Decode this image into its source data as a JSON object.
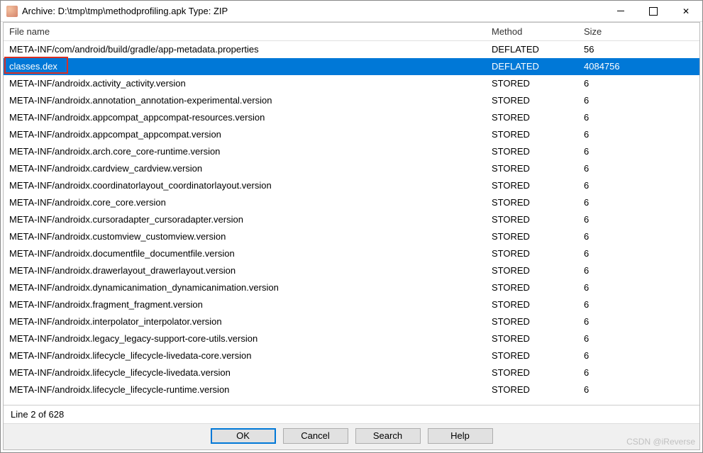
{
  "window": {
    "title": "Archive: D:\\tmp\\tmp\\methodprofiling.apk Type: ZIP"
  },
  "columns": {
    "name": "File name",
    "method": "Method",
    "size": "Size"
  },
  "rows": [
    {
      "name": "META-INF/com/android/build/gradle/app-metadata.properties",
      "method": "DEFLATED",
      "size": "56",
      "selected": false
    },
    {
      "name": "classes.dex",
      "method": "DEFLATED",
      "size": "4084756",
      "selected": true,
      "highlighted": true
    },
    {
      "name": "META-INF/androidx.activity_activity.version",
      "method": "STORED",
      "size": "6",
      "selected": false
    },
    {
      "name": "META-INF/androidx.annotation_annotation-experimental.version",
      "method": "STORED",
      "size": "6",
      "selected": false
    },
    {
      "name": "META-INF/androidx.appcompat_appcompat-resources.version",
      "method": "STORED",
      "size": "6",
      "selected": false
    },
    {
      "name": "META-INF/androidx.appcompat_appcompat.version",
      "method": "STORED",
      "size": "6",
      "selected": false
    },
    {
      "name": "META-INF/androidx.arch.core_core-runtime.version",
      "method": "STORED",
      "size": "6",
      "selected": false
    },
    {
      "name": "META-INF/androidx.cardview_cardview.version",
      "method": "STORED",
      "size": "6",
      "selected": false
    },
    {
      "name": "META-INF/androidx.coordinatorlayout_coordinatorlayout.version",
      "method": "STORED",
      "size": "6",
      "selected": false
    },
    {
      "name": "META-INF/androidx.core_core.version",
      "method": "STORED",
      "size": "6",
      "selected": false
    },
    {
      "name": "META-INF/androidx.cursoradapter_cursoradapter.version",
      "method": "STORED",
      "size": "6",
      "selected": false
    },
    {
      "name": "META-INF/androidx.customview_customview.version",
      "method": "STORED",
      "size": "6",
      "selected": false
    },
    {
      "name": "META-INF/androidx.documentfile_documentfile.version",
      "method": "STORED",
      "size": "6",
      "selected": false
    },
    {
      "name": "META-INF/androidx.drawerlayout_drawerlayout.version",
      "method": "STORED",
      "size": "6",
      "selected": false
    },
    {
      "name": "META-INF/androidx.dynamicanimation_dynamicanimation.version",
      "method": "STORED",
      "size": "6",
      "selected": false
    },
    {
      "name": "META-INF/androidx.fragment_fragment.version",
      "method": "STORED",
      "size": "6",
      "selected": false
    },
    {
      "name": "META-INF/androidx.interpolator_interpolator.version",
      "method": "STORED",
      "size": "6",
      "selected": false
    },
    {
      "name": "META-INF/androidx.legacy_legacy-support-core-utils.version",
      "method": "STORED",
      "size": "6",
      "selected": false
    },
    {
      "name": "META-INF/androidx.lifecycle_lifecycle-livedata-core.version",
      "method": "STORED",
      "size": "6",
      "selected": false
    },
    {
      "name": "META-INF/androidx.lifecycle_lifecycle-livedata.version",
      "method": "STORED",
      "size": "6",
      "selected": false
    },
    {
      "name": "META-INF/androidx.lifecycle_lifecycle-runtime.version",
      "method": "STORED",
      "size": "6",
      "selected": false
    }
  ],
  "status": "Line 2 of 628",
  "buttons": {
    "ok": "OK",
    "cancel": "Cancel",
    "search": "Search",
    "help": "Help"
  },
  "watermark": "CSDN @iReverse"
}
